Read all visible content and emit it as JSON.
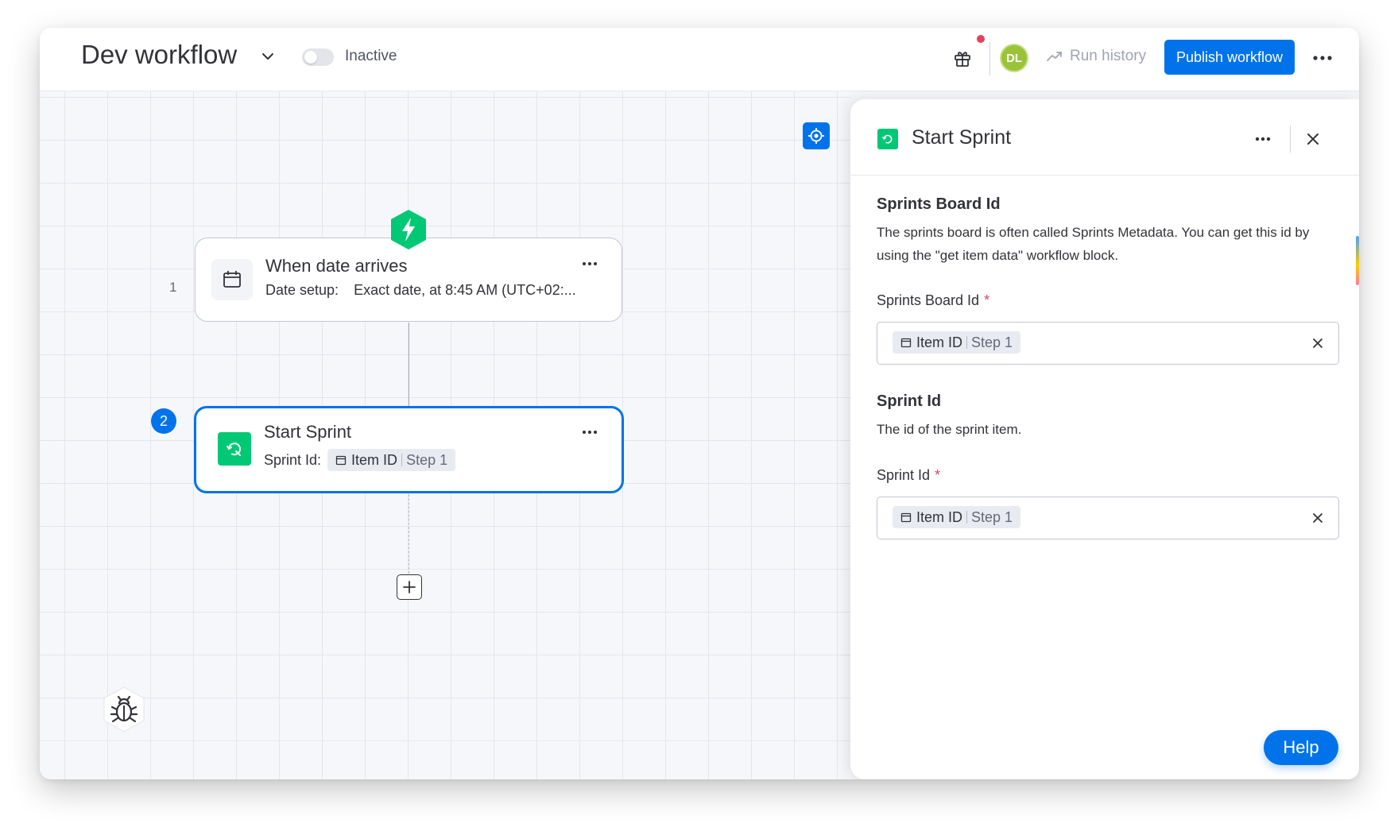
{
  "header": {
    "title": "Dev workflow",
    "status_label": "Inactive",
    "avatar_initials": "DL",
    "run_history_label": "Run history",
    "publish_label": "Publish workflow"
  },
  "canvas": {
    "nodes": [
      {
        "number": "1",
        "title": "When date arrives",
        "subtitle_label": "Date setup:",
        "subtitle_value": "Exact date, at 8:45 AM (UTC+02:..."
      },
      {
        "number": "2",
        "title": "Start Sprint",
        "subtitle_label": "Sprint Id:",
        "chip": {
          "name": "Item ID",
          "step": "Step 1"
        }
      }
    ]
  },
  "panel": {
    "title": "Start Sprint",
    "sections": [
      {
        "title": "Sprints Board Id",
        "description": "The sprints board is often called Sprints Metadata. You can get this id by using the \"get item data\" workflow block.",
        "field_label": "Sprints Board Id",
        "required_mark": "*",
        "chip": {
          "name": "Item ID",
          "step": "Step 1"
        }
      },
      {
        "title": "Sprint Id",
        "description": "The id of the sprint item.",
        "field_label": "Sprint Id",
        "required_mark": "*",
        "chip": {
          "name": "Item ID",
          "step": "Step 1"
        }
      }
    ],
    "help_label": "Help"
  },
  "colors": {
    "primary": "#0073ea",
    "green": "#00c875",
    "avatar": "#9ac339",
    "danger": "#e2445c"
  },
  "icons": [
    "chevron-down-icon",
    "gift-icon",
    "run-history-icon",
    "more-icon",
    "recenter-icon",
    "lightning-icon",
    "calendar-icon",
    "sprint-icon",
    "plus-icon",
    "bug-icon",
    "close-icon"
  ]
}
